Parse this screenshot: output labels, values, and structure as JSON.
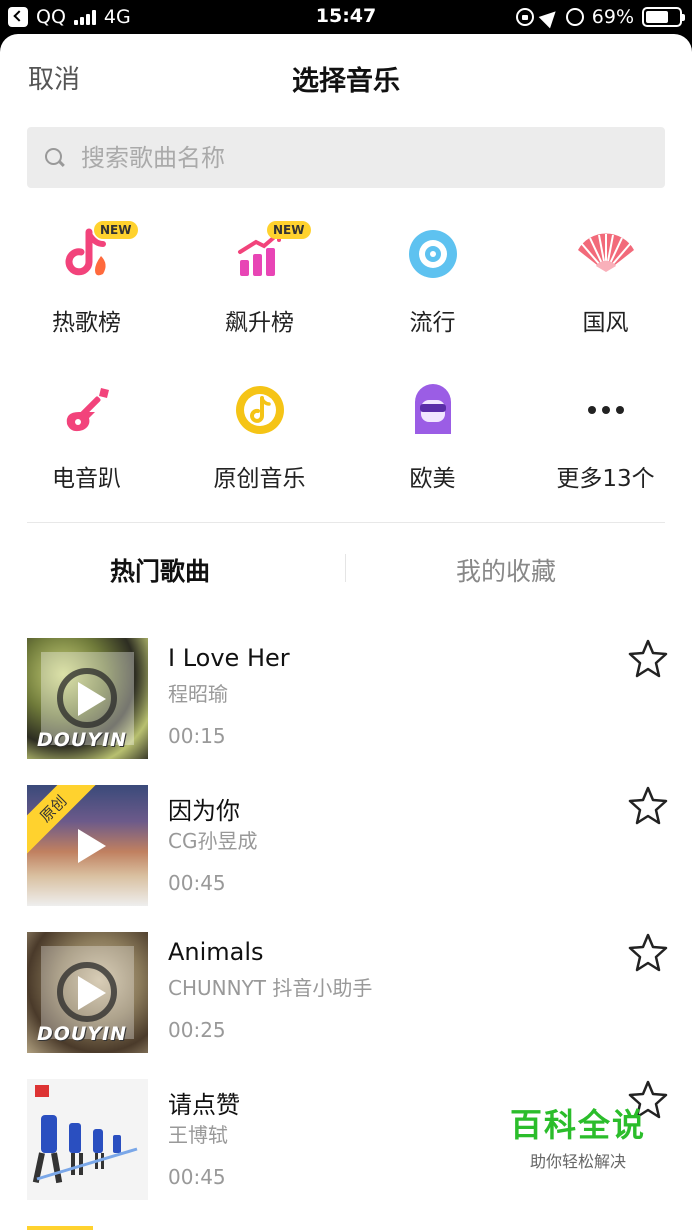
{
  "status_bar": {
    "carrier": "QQ",
    "network": "4G",
    "time": "15:47",
    "battery": "69%",
    "battery_level": 0.69,
    "icons": [
      "back-icon",
      "signal-icon",
      "rotation-lock-icon",
      "location-icon",
      "alarm-icon",
      "battery-icon"
    ]
  },
  "header": {
    "cancel_label": "取消",
    "title": "选择音乐"
  },
  "search": {
    "placeholder": "搜索歌曲名称"
  },
  "categories": [
    {
      "label": "热歌榜",
      "icon": "hot-songs-icon",
      "badge": "NEW"
    },
    {
      "label": "飙升榜",
      "icon": "rising-chart-icon",
      "badge": "NEW"
    },
    {
      "label": "流行",
      "icon": "pop-disc-icon"
    },
    {
      "label": "国风",
      "icon": "folding-fan-icon"
    },
    {
      "label": "电音趴",
      "icon": "electric-guitar-icon"
    },
    {
      "label": "原创音乐",
      "icon": "original-music-icon"
    },
    {
      "label": "欧美",
      "icon": "western-avatar-icon"
    },
    {
      "label": "更多13个",
      "icon": "more-dots-icon"
    }
  ],
  "tabs": {
    "hot": "热门歌曲",
    "favorites": "我的收藏"
  },
  "songs": [
    {
      "name": "I Love Her",
      "artist": "程昭瑜",
      "duration": "00:15",
      "cover_text": "DOUYIN"
    },
    {
      "name": "因为你",
      "artist": "CG孙昱成",
      "duration": "00:45",
      "badge": "原创"
    },
    {
      "name": "Animals",
      "artist": "CHUNNYT 抖音小助手",
      "duration": "00:25",
      "cover_text": "DOUYIN"
    },
    {
      "name": "请点赞",
      "artist": "王博轼",
      "duration": "00:45"
    }
  ],
  "watermark": {
    "main": "百科全说",
    "sub": "助你轻松解决"
  },
  "colors": {
    "accent_yellow": "#ffd22e",
    "hot_pink": "#f2437b",
    "pop_blue": "#5ec2f0",
    "fan_red": "#f26a7a",
    "original_gold": "#f5c416",
    "western_purple": "#9b5de5",
    "watermark_green": "#2bbd2b"
  }
}
